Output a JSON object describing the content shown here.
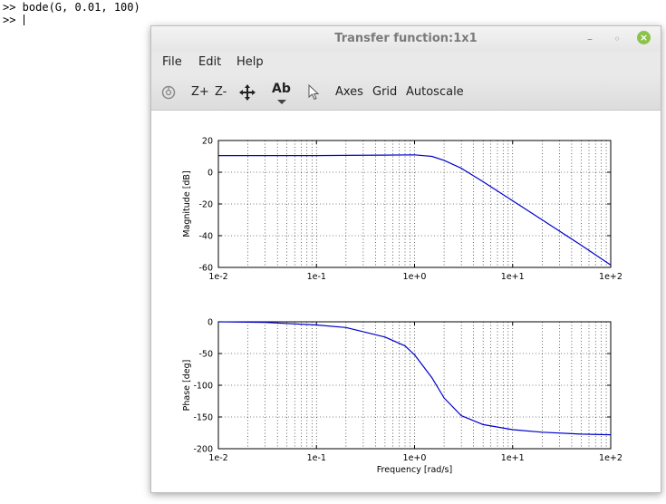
{
  "console": {
    "line1": ">> bode(G, 0.01, 100)",
    "line2": ">> "
  },
  "window": {
    "title": "Transfer function:1x1",
    "minimize_glyph": "–",
    "restore_glyph": "◦",
    "close_glyph": "×"
  },
  "menubar": {
    "file": "File",
    "edit": "Edit",
    "help": "Help"
  },
  "toolbar": {
    "rotate_icon": "rotate-icon",
    "zoom_in": "Z+",
    "zoom_out": "Z-",
    "pan_icon": "pan-icon",
    "text_icon_label": "Ab",
    "pointer_icon": "pointer-icon",
    "axes": "Axes",
    "grid": "Grid",
    "autoscale": "Autoscale"
  },
  "colors": {
    "series": "#0000cc",
    "close_button": "#8bc34a"
  },
  "chart_data": [
    {
      "type": "line",
      "ylabel": "Magnitude [dB]",
      "xlabel": "",
      "xscale": "log",
      "xlim": [
        0.01,
        100
      ],
      "ylim": [
        -60,
        20
      ],
      "xticks": [
        "1e-2",
        "1e-1",
        "1e+0",
        "1e+1",
        "1e+2"
      ],
      "yticks": [
        "20",
        "0",
        "-20",
        "-40",
        "-60"
      ],
      "grid": true,
      "series": [
        {
          "x": [
            0.01,
            0.1,
            0.5,
            1,
            1.5,
            2,
            3,
            5,
            10,
            20,
            50,
            100
          ],
          "y": [
            10.5,
            10.5,
            10.8,
            11.0,
            10.0,
            7.5,
            2.5,
            -6.0,
            -18.0,
            -30.0,
            -46.0,
            -58.5
          ]
        }
      ]
    },
    {
      "type": "line",
      "ylabel": "Phase [deg]",
      "xlabel": "Frequency [rad/s]",
      "xscale": "log",
      "xlim": [
        0.01,
        100
      ],
      "ylim": [
        -200,
        0
      ],
      "xticks": [
        "1e-2",
        "1e-1",
        "1e+0",
        "1e+1",
        "1e+2"
      ],
      "yticks": [
        "0",
        "-50",
        "-100",
        "-150",
        "-200"
      ],
      "grid": true,
      "series": [
        {
          "x": [
            0.01,
            0.03,
            0.1,
            0.2,
            0.5,
            0.8,
            1,
            1.5,
            2,
            3,
            5,
            10,
            20,
            50,
            100
          ],
          "y": [
            0,
            -1,
            -5,
            -9,
            -24,
            -38,
            -52,
            -88,
            -120,
            -148,
            -162,
            -170,
            -174,
            -177,
            -178
          ]
        }
      ]
    }
  ]
}
